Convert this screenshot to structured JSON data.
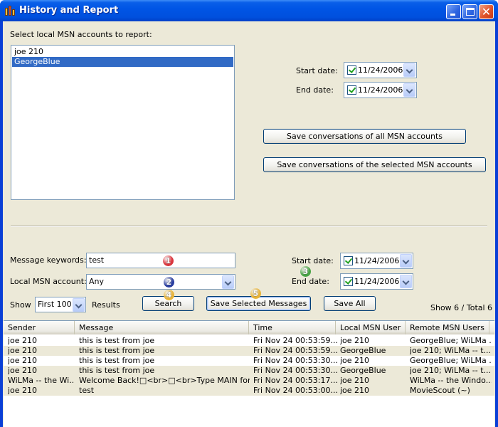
{
  "window": {
    "title": "History and Report",
    "controls": {
      "minimize": "minimize",
      "maximize": "maximize",
      "close": "✕"
    }
  },
  "accounts": {
    "label": "Select local MSN accounts to report:",
    "items": [
      {
        "label": "joe 210",
        "selected": false
      },
      {
        "label": "GeorgeBlue",
        "selected": true
      }
    ]
  },
  "report": {
    "start_label": "Start date:",
    "start_value": "11/24/2006",
    "end_label": "End date:",
    "end_value": "11/24/2006",
    "save_all_label": "Save conversations of all MSN accounts",
    "save_selected_label": "Save conversations of the selected MSN accounts"
  },
  "search": {
    "keywords_label": "Message keywords:",
    "keywords_value": "test",
    "account_label": "Local MSN account:",
    "account_value": "Any",
    "start_label": "Start date:",
    "start_value": "11/24/2006",
    "end_label": "End date:",
    "end_value": "11/24/2006",
    "show_label": "Show",
    "show_value": "First 100",
    "results_label": "Results",
    "search_button": "Search",
    "save_selected_button": "Save Selected Messages",
    "save_all_button": "Save All",
    "status": "Show 6 / Total 6"
  },
  "badges": {
    "b1": {
      "num": "1",
      "color": "#d9363e"
    },
    "b2": {
      "num": "2",
      "color": "#2b3fa0"
    },
    "b3": {
      "num": "3",
      "color": "#4aa446"
    },
    "b4": {
      "num": "4",
      "color": "#e8b43a"
    },
    "b5": {
      "num": "5",
      "color": "#e8b43a"
    }
  },
  "table": {
    "columns": [
      "Sender",
      "Message",
      "Time",
      "Local MSN User",
      "Remote MSN Users"
    ],
    "rows": [
      [
        "joe 210",
        "this is test from joe",
        "Fri Nov 24 00:53:59...",
        "joe 210",
        "GeorgeBlue; WiLMa ..."
      ],
      [
        "joe 210",
        "this is test from joe",
        "Fri Nov 24 00:53:59...",
        "GeorgeBlue",
        "joe 210; WiLMa -- t..."
      ],
      [
        "joe 210",
        "this is test from joe",
        "Fri Nov 24 00:53:30...",
        "joe 210",
        "GeorgeBlue; WiLMa ..."
      ],
      [
        "joe 210",
        "this is test from joe",
        "Fri Nov 24 00:53:30...",
        "GeorgeBlue",
        "joe 210; WiLMa -- t..."
      ],
      [
        "WiLMa -- the Wi...",
        "Welcome Back!□<br>□<br>Type MAIN for ...",
        "Fri Nov 24 00:53:17...",
        "joe 210",
        "WiLMa -- the Windo..."
      ],
      [
        "joe 210",
        "test",
        "Fri Nov 24 00:53:00...",
        "joe 210",
        "MovieScout (~)"
      ]
    ]
  }
}
